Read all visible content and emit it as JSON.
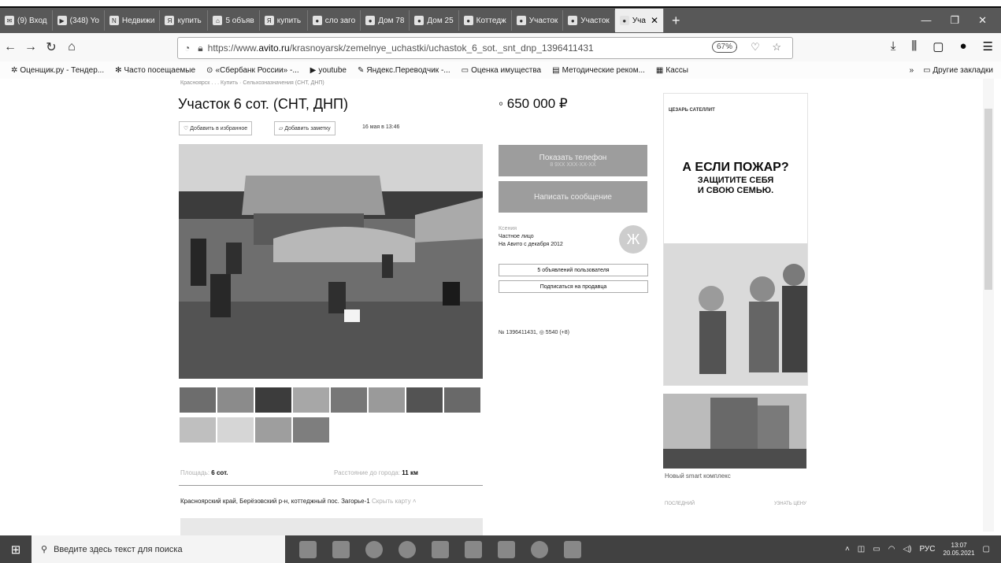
{
  "tabs": [
    {
      "label": "(9) Вход",
      "icon": "mail-icon"
    },
    {
      "label": "(348) Yo",
      "icon": "youtube-icon"
    },
    {
      "label": "Недвижи",
      "icon": "realty-icon"
    },
    {
      "label": "купить",
      "icon": "yandex-icon"
    },
    {
      "label": "5 объяв",
      "icon": "cian-icon"
    },
    {
      "label": "купить",
      "icon": "yandex-icon"
    },
    {
      "label": "сло заго",
      "icon": "avito-icon"
    },
    {
      "label": "Дом 78",
      "icon": "avito-icon"
    },
    {
      "label": "Дом 25",
      "icon": "avito-icon"
    },
    {
      "label": "Коттедж",
      "icon": "avito-icon"
    },
    {
      "label": "Участок",
      "icon": "avito-icon"
    },
    {
      "label": "Участок",
      "icon": "avito-icon"
    },
    {
      "label": "Уча",
      "icon": "avito-icon",
      "active": true
    }
  ],
  "browser": {
    "url_prefix": "https://www.",
    "url_domain": "avito.ru",
    "url_path": "/krasnoyarsk/zemelnye_uchastki/uchastok_6_sot._snt_dnp_1396411431",
    "zoom": "67%"
  },
  "bookmarks": [
    "Оценщик.ру - Тендер...",
    "Часто посещаемые",
    "«Сбербанк России» -...",
    "youtube",
    "Яндекс.Переводчик -...",
    "Оценка имущества",
    "Методические реком...",
    "Кассы"
  ],
  "bookmarks_other": "Другие закладки",
  "listing": {
    "breadcrumb": "Красноярск . . . Купить · Сельхозназначения (СНТ, ДНП)",
    "title": "Участок 6 сот. (СНТ, ДНП)",
    "price": "650 000 ₽",
    "favorite_label": "Добавить в избранное",
    "note_label": "Добавить заметку",
    "date": "16 мая в 13:46",
    "area_label": "Площадь:",
    "area_value": "6 сот.",
    "distance_label": "Расстояние до города:",
    "distance_value": "11 км",
    "address": "Красноярский край, Берёзовский р-н, коттеджный пос. Загорье-1",
    "hide_map": "Скрыть карту",
    "ad_number": "№ 1396411431, ◎ 5540 (+8)"
  },
  "sidebar": {
    "phone_button": "Показать телефон",
    "phone_sub": "8 9XX XXX-XX-XX",
    "message_button": "Написать сообщение",
    "seller_name": "Ксения",
    "seller_type": "Частное лицо",
    "seller_since": "На Авито с декабря 2012",
    "avatar_letter": "Ж",
    "user_ads": "5 объявлений пользователя",
    "subscribe": "Подписаться на продавца"
  },
  "ads": {
    "brand": "ЦЕЗАРЬ САТЕЛЛИТ",
    "headline": "А ЕСЛИ ПОЖАР?",
    "subline_1": "ЗАЩИТИТЕ СЕБЯ",
    "subline_2": "И СВОЮ СЕМЬЮ.",
    "promo_text": "Новый smart комплекс",
    "promo_left": "ПОСЛЕДНИЙ",
    "promo_right": "УЗНАТЬ ЦЕНУ"
  },
  "taskbar": {
    "search_placeholder": "Введите здесь текст для поиска",
    "lang": "РУС",
    "time": "13:07",
    "date": "20.05.2021"
  }
}
